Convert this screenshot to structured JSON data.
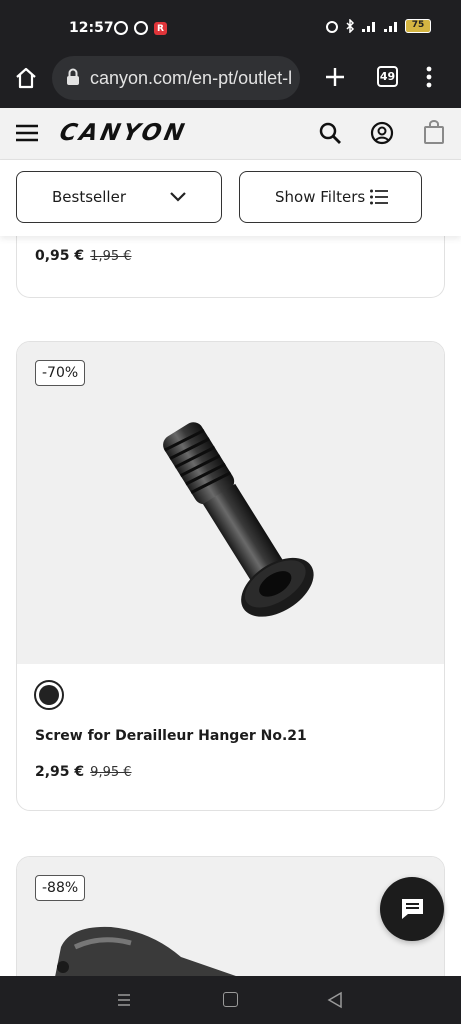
{
  "status_bar": {
    "time": "12:57",
    "battery": "75"
  },
  "browser": {
    "url": "canyon.com/en-pt/outlet-l",
    "tab_count": "49"
  },
  "site_header": {
    "logo": "CANYON"
  },
  "toolbar": {
    "sort_label": "Bestseller",
    "filter_label": "Show Filters"
  },
  "products": [
    {
      "price": "0,95 €",
      "old_price": "1,95 €"
    },
    {
      "badge": "-70%",
      "title": "Screw for Derailleur Hanger No.21",
      "price": "2,95 €",
      "old_price": "9,95 €",
      "swatch_color": "#222222"
    },
    {
      "badge": "-88%"
    }
  ],
  "icons": [
    "home-icon",
    "lock-icon",
    "plus-icon",
    "more-icon",
    "hamburger-icon",
    "search-icon",
    "account-icon",
    "bag-icon",
    "chevron-down-icon",
    "filter-list-icon",
    "chat-icon"
  ],
  "colors": {
    "chrome_bg": "#1f1f22",
    "header_bg": "#f2f2f2",
    "image_bg": "#f0f0f0",
    "chat_bg": "#1c1c1c"
  }
}
